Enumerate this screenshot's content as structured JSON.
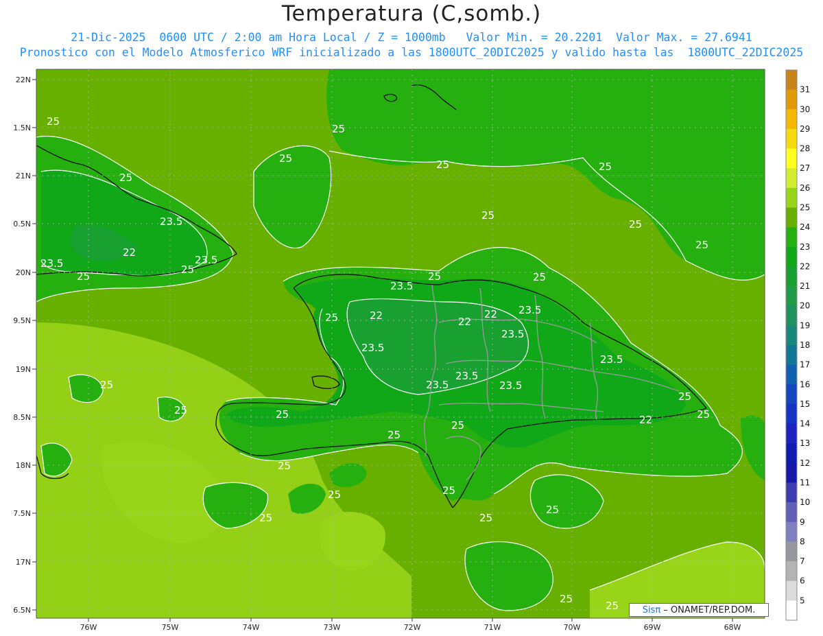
{
  "title": "Temperatura (C,somb.)",
  "subtitle_line1": "21-Dic-2025  0600 UTC / 2:00 am Hora Local / Z = 1000mb   Valor Min. = 20.2201  Valor Max. = 27.6941",
  "subtitle_line2": "Pronostico con el Modelo Atmosferico WRF inicializado a las 1800UTC_20DIC2025 y valido hasta las  1800UTC_22DIC2025",
  "credit_brand": "Sisπ",
  "credit_text": " – ONAMET/REP.DOM.",
  "axes": {
    "y_ticks": [
      "22N",
      "1.5N",
      "21N",
      "0.5N",
      "20N",
      "9.5N",
      "19N",
      "8.5N",
      "18N",
      "7.5N",
      "17N",
      "6.5N"
    ],
    "x_ticks": [
      "76W",
      "75W",
      "74W",
      "73W",
      "72W",
      "71W",
      "70W",
      "69W",
      "68W"
    ]
  },
  "colorbar": {
    "labels": [
      "31",
      "30",
      "29",
      "28",
      "27",
      "26",
      "25",
      "24",
      "23",
      "22",
      "21",
      "20",
      "19",
      "18",
      "17",
      "16",
      "15",
      "14",
      "13",
      "12",
      "11",
      "10",
      "9",
      "8",
      "7",
      "6",
      "5"
    ],
    "colors": [
      "#c8841a",
      "#e09a08",
      "#f5b800",
      "#f6da10",
      "#ffff22",
      "#d4ec30",
      "#98d418",
      "#68b000",
      "#26b010",
      "#10a818",
      "#18a030",
      "#239a48",
      "#1f9060",
      "#18867a",
      "#127694",
      "#1060b0",
      "#1446bc",
      "#1434c4",
      "#1c24c0",
      "#101cb0",
      "#1818a8",
      "#3c3cb0",
      "#6060b8",
      "#8080c0",
      "#9898a0",
      "#b4b4b4",
      "#dcdcdc",
      "#ffffff"
    ]
  },
  "contour_labels": [
    "25",
    "25",
    "25",
    "25",
    "25",
    "25",
    "25",
    "25",
    "25",
    "25",
    "25",
    "25",
    "25",
    "25",
    "25",
    "25",
    "25",
    "25",
    "25",
    "25",
    "25",
    "25",
    "25",
    "25",
    "25",
    "25",
    "25",
    "25",
    "25",
    "23.5",
    "23.5",
    "23.5",
    "23.5",
    "23.5",
    "23.5",
    "23.5",
    "23.5",
    "23.5",
    "23.5",
    "23.5",
    "22",
    "22",
    "22",
    "22",
    "22"
  ]
}
